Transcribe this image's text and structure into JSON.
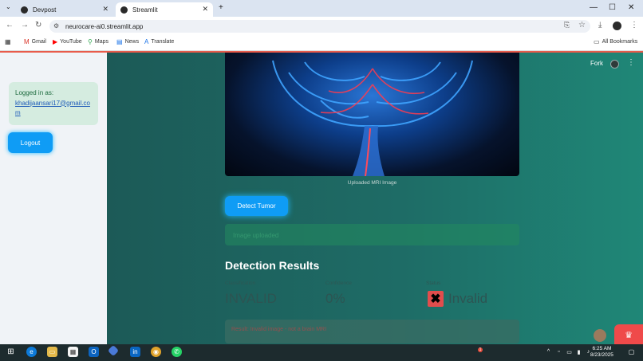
{
  "browser": {
    "tabs": [
      {
        "title": "Devpost",
        "active": false
      },
      {
        "title": "Streamlit",
        "active": true
      }
    ],
    "new_tab": "+",
    "window": {
      "minimize": "—",
      "maximize": "☐",
      "close": "✕"
    },
    "url": "neurocare-ai0.streamlit.app",
    "bookmarks": [
      "Gmail",
      "YouTube",
      "Maps",
      "News",
      "Translate"
    ],
    "all_bookmarks": "All Bookmarks"
  },
  "sidebar": {
    "logged_in_label": "Logged in as:",
    "email": "khadijaansari17@gmail.com",
    "logout_label": "Logout"
  },
  "header": {
    "fork_label": "Fork"
  },
  "main": {
    "image_caption": "Uploaded MRI Image",
    "detect_button": "Detect Tumor",
    "success_message": "Image uploaded",
    "results_title": "Detection Results",
    "metrics": [
      {
        "label": "Classification",
        "value": "INVALID"
      },
      {
        "label": "Confidence",
        "value": "0%"
      },
      {
        "label": "Status",
        "value": "Invalid"
      }
    ],
    "error_message": "Result: Invalid image - not a brain MRI",
    "status_icon": "✖"
  },
  "taskbar": {
    "time": "6:25 AM",
    "date": "8/23/2025",
    "notification_badge": "1"
  },
  "colors": {
    "accent": "#0f9cf5",
    "error": "#e14d4d",
    "main_bg": "#1e6c66"
  }
}
